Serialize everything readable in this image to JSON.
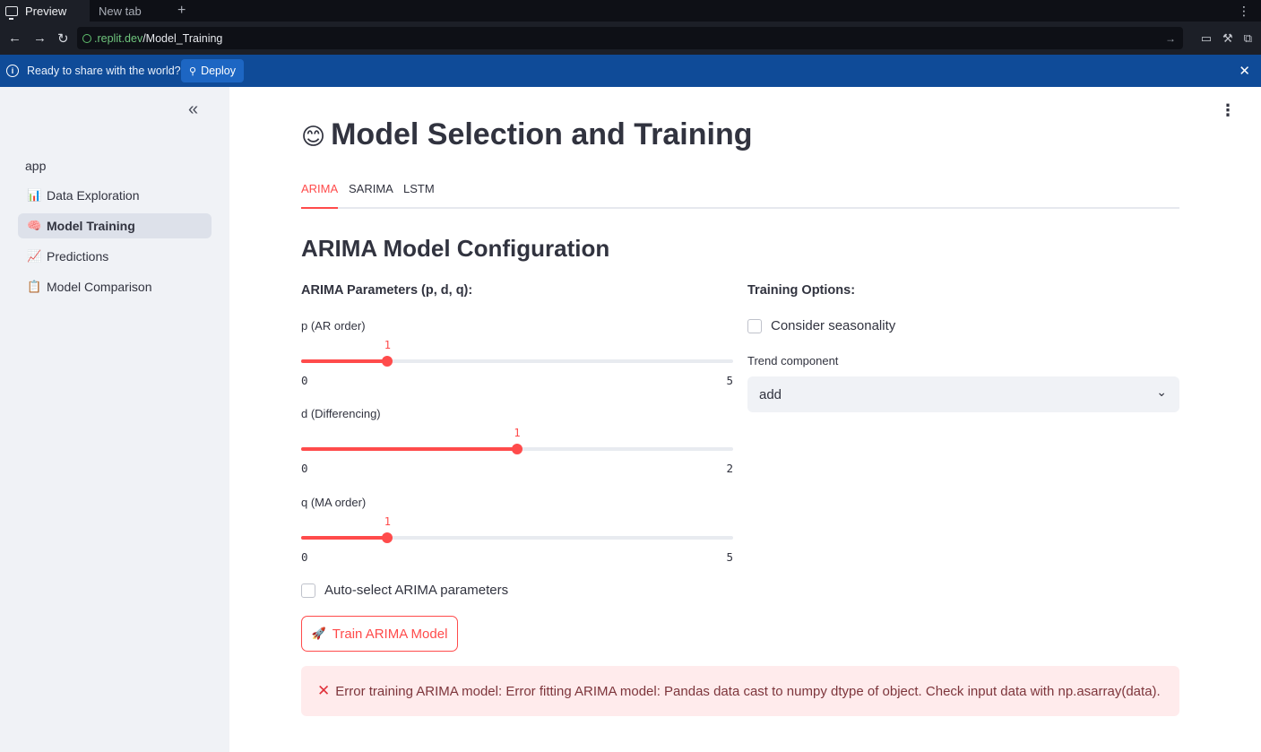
{
  "browser": {
    "tabs": [
      {
        "label": "Preview",
        "icon": "monitor-icon",
        "active": true
      },
      {
        "label": "New tab",
        "active": false
      }
    ],
    "new_tab": "+",
    "url_host": ".replit.dev",
    "url_path": "/Model_Training"
  },
  "deploy_banner": {
    "text": "Ready to share with the world?",
    "button": "Deploy",
    "button_icon": "balloon-icon"
  },
  "sidebar": {
    "app_label": "app",
    "collapse_icon": "«",
    "items": [
      {
        "label": "Data Exploration",
        "icon": "📊",
        "active": false
      },
      {
        "label": "Model Training",
        "icon": "🧠",
        "active": true
      },
      {
        "label": "Predictions",
        "icon": "📈",
        "active": false
      },
      {
        "label": "Model Comparison",
        "icon": "📋",
        "active": false
      }
    ]
  },
  "main": {
    "title": "Model Selection and Training",
    "title_icon": "😊",
    "tabs": [
      {
        "label": "ARIMA",
        "active": true
      },
      {
        "label": "SARIMA",
        "active": false
      },
      {
        "label": "LSTM",
        "active": false
      }
    ],
    "section_title": "ARIMA Model Configuration",
    "params_header": "ARIMA Parameters (p, d, q):",
    "training_header": "Training Options:",
    "sliders": [
      {
        "label": "p (AR order)",
        "value": 1,
        "min": 0,
        "max": 5
      },
      {
        "label": "d (Differencing)",
        "value": 1,
        "min": 0,
        "max": 2
      },
      {
        "label": "q (MA order)",
        "value": 1,
        "min": 0,
        "max": 5
      }
    ],
    "seasonality_label": "Consider seasonality",
    "seasonality_checked": false,
    "trend_label": "Trend component",
    "trend_value": "add",
    "auto_select_label": "Auto-select ARIMA parameters",
    "auto_select_checked": false,
    "train_button": "Train ARIMA Model",
    "train_button_icon": "🚀",
    "error_icon": "✕",
    "error_message": "Error training ARIMA model: Error fitting ARIMA model: Pandas data cast to numpy dtype of object. Check input data with np.asarray(data)."
  },
  "colors": {
    "accent": "#ff4b4b",
    "sidebar_bg": "#f0f2f6",
    "banner_bg": "#0f4b98",
    "error_bg": "#ffebec",
    "error_text": "#7d353b"
  }
}
